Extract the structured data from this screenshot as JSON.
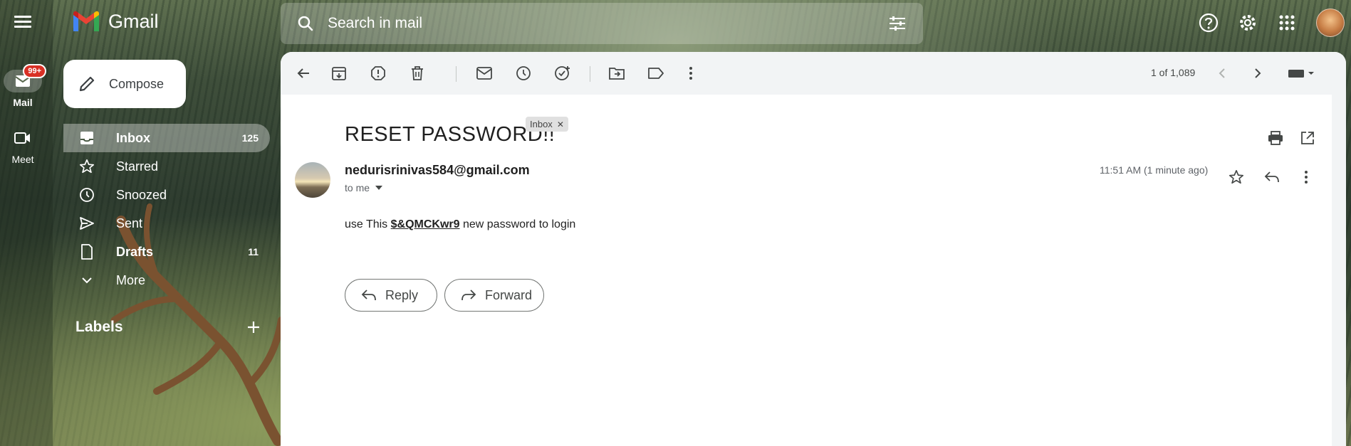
{
  "app": {
    "name": "Gmail"
  },
  "rail": {
    "mail": {
      "label": "Mail",
      "badge": "99+"
    },
    "meet": {
      "label": "Meet"
    }
  },
  "search": {
    "placeholder": "Search in mail"
  },
  "sidebar": {
    "compose_label": "Compose",
    "items": [
      {
        "label": "Inbox",
        "count": "125",
        "icon": "inbox-icon"
      },
      {
        "label": "Starred",
        "count": "",
        "icon": "star-icon"
      },
      {
        "label": "Snoozed",
        "count": "",
        "icon": "clock-icon"
      },
      {
        "label": "Sent",
        "count": "",
        "icon": "send-icon"
      },
      {
        "label": "Drafts",
        "count": "11",
        "icon": "draft-icon"
      },
      {
        "label": "More",
        "count": "",
        "icon": "chevron-down-icon"
      }
    ],
    "labels_heading": "Labels"
  },
  "toolbar": {
    "pager": "1 of 1,089"
  },
  "email": {
    "subject": "RESET PASSWORD!!",
    "chip": "Inbox",
    "sender": "nedurisrinivas584@gmail.com",
    "to": "to me",
    "time": "11:51 AM (1 minute ago)",
    "body_prefix": "use This ",
    "body_code": "$&QMCKwr9",
    "body_suffix": " new password to login",
    "reply_label": "Reply",
    "forward_label": "Forward"
  },
  "colors": {
    "accent_badge": "#d93025",
    "panel_bg": "#ffffff",
    "toolbar_bg": "#f2f4f5"
  }
}
